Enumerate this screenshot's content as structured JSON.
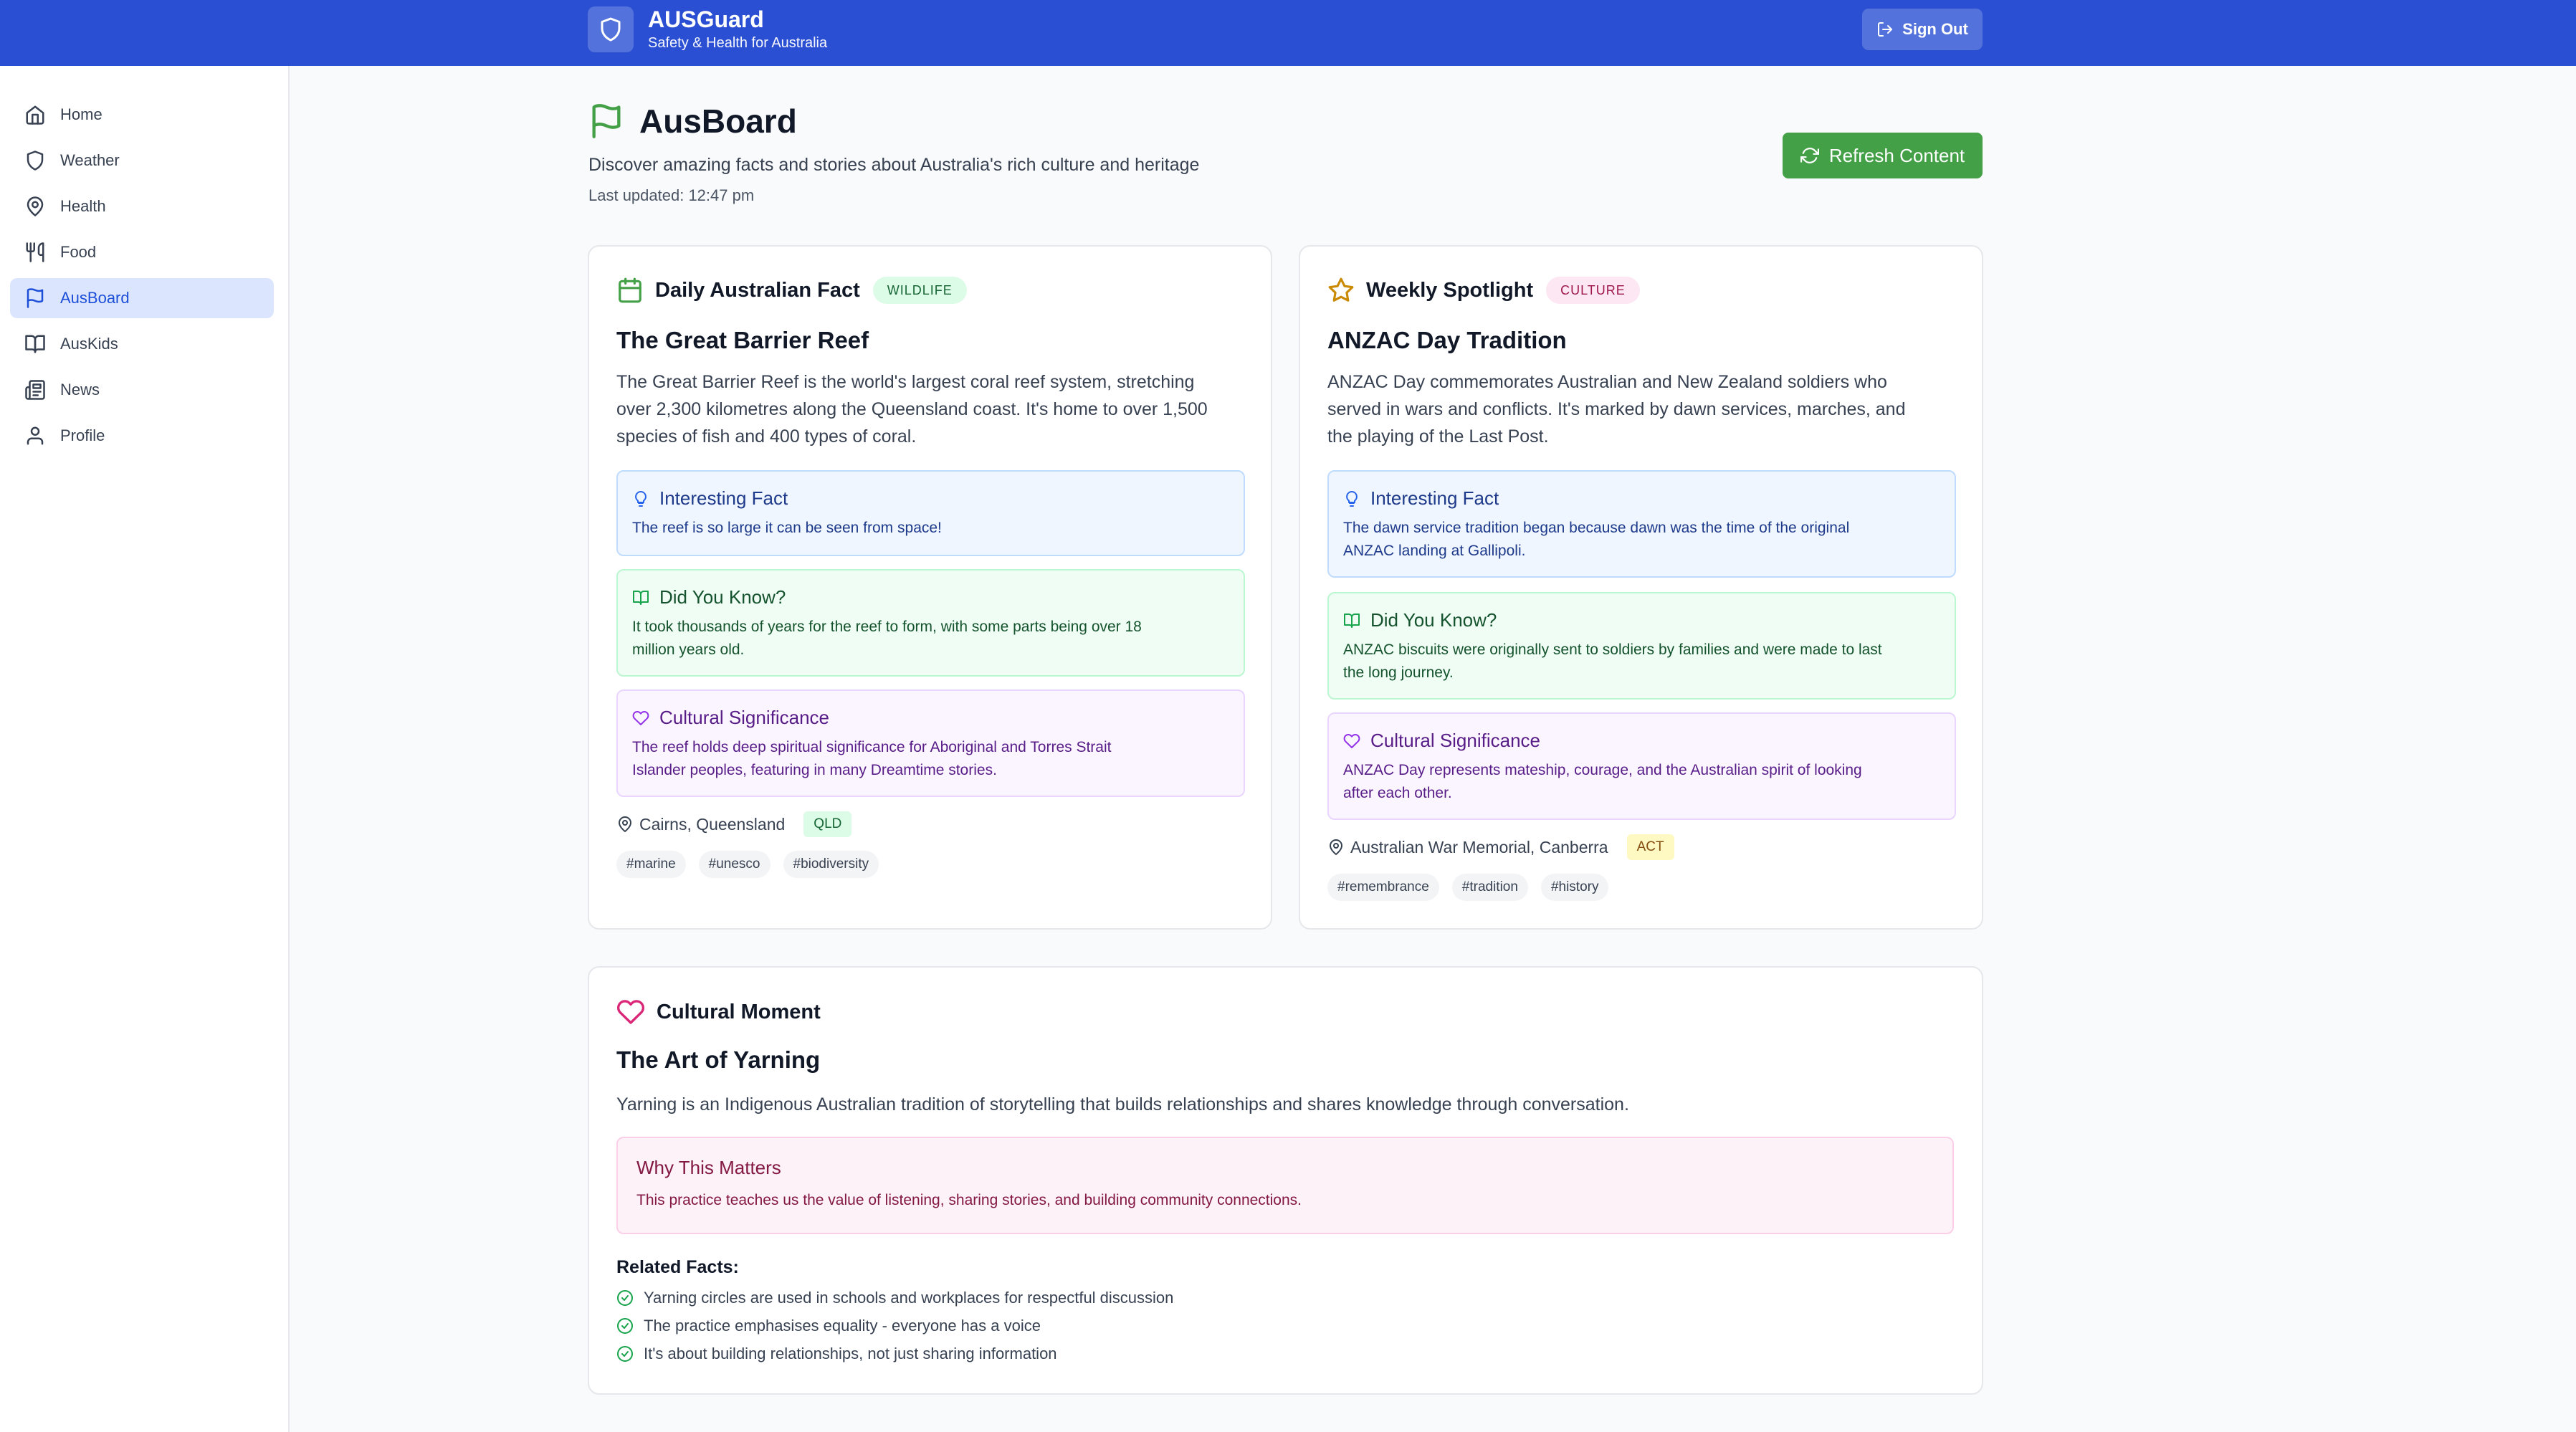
{
  "header": {
    "app_name": "AUSGuard",
    "tagline": "Safety & Health for Australia",
    "sign_out": "Sign Out",
    "brand_color": "#2a4fd3"
  },
  "sidebar": {
    "items": [
      {
        "label": "Home",
        "icon": "home-icon"
      },
      {
        "label": "Weather",
        "icon": "shield-icon"
      },
      {
        "label": "Health",
        "icon": "map-pin-icon"
      },
      {
        "label": "Food",
        "icon": "utensils-icon"
      },
      {
        "label": "AusBoard",
        "icon": "flag-icon",
        "active": true
      },
      {
        "label": "AusKids",
        "icon": "book-open-icon"
      },
      {
        "label": "News",
        "icon": "newspaper-icon"
      },
      {
        "label": "Profile",
        "icon": "user-icon"
      }
    ]
  },
  "page": {
    "title": "AusBoard",
    "description": "Discover amazing facts and stories about Australia's rich culture and heritage",
    "last_updated": "Last updated: 12:47 pm",
    "refresh_label": "Refresh Content",
    "refresh_color": "#43a047"
  },
  "daily_fact": {
    "header": "Daily Australian Fact",
    "category": "WILDLIFE",
    "title": "The Great Barrier Reef",
    "body_lines": [
      "The Great Barrier Reef is the world's largest coral reef system, stretching",
      "over 2,300 kilometres along the Queensland coast. It's home to over 1,500",
      "species of fish and 400 types of coral."
    ],
    "interesting_title": "Interesting Fact",
    "interesting_lines": [
      "The reef is so large it can be seen from space!"
    ],
    "did_you_know_title": "Did You Know?",
    "did_you_know_lines": [
      "It took thousands of years for the reef to form, with some parts being over 18",
      "million years old."
    ],
    "cultural_title": "Cultural Significance",
    "cultural_lines": [
      "The reef holds deep spiritual significance for Aboriginal and Torres Strait",
      "Islander peoples, featuring in many Dreamtime stories."
    ],
    "location": "Cairns, Queensland",
    "state": "QLD",
    "tags": [
      "#marine",
      "#unesco",
      "#biodiversity"
    ]
  },
  "weekly_spotlight": {
    "header": "Weekly Spotlight",
    "category": "CULTURE",
    "title": "ANZAC Day Tradition",
    "body_lines": [
      "ANZAC Day commemorates Australian and New Zealand soldiers who",
      "served in wars and conflicts. It's marked by dawn services, marches, and",
      "the playing of the Last Post."
    ],
    "interesting_title": "Interesting Fact",
    "interesting_lines": [
      "The dawn service tradition began because dawn was the time of the original",
      "ANZAC landing at Gallipoli."
    ],
    "did_you_know_title": "Did You Know?",
    "did_you_know_lines": [
      "ANZAC biscuits were originally sent to soldiers by families and were made to last",
      "the long journey."
    ],
    "cultural_title": "Cultural Significance",
    "cultural_lines": [
      "ANZAC Day represents mateship, courage, and the Australian spirit of looking",
      "after each other."
    ],
    "location": "Australian War Memorial, Canberra",
    "state": "ACT",
    "tags": [
      "#remembrance",
      "#tradition",
      "#history"
    ]
  },
  "cultural_moment": {
    "header": "Cultural Moment",
    "title": "The Art of Yarning",
    "body": "Yarning is an Indigenous Australian tradition of storytelling that builds relationships and shares knowledge through conversation.",
    "why_title": "Why This Matters",
    "why_text": "This practice teaches us the value of listening, sharing stories, and building community connections.",
    "related_title": "Related Facts:",
    "related": [
      "Yarning circles are used in schools and workplaces for respectful discussion",
      "The practice emphasises equality - everyone has a voice",
      "It's about building relationships, not just sharing information"
    ]
  }
}
